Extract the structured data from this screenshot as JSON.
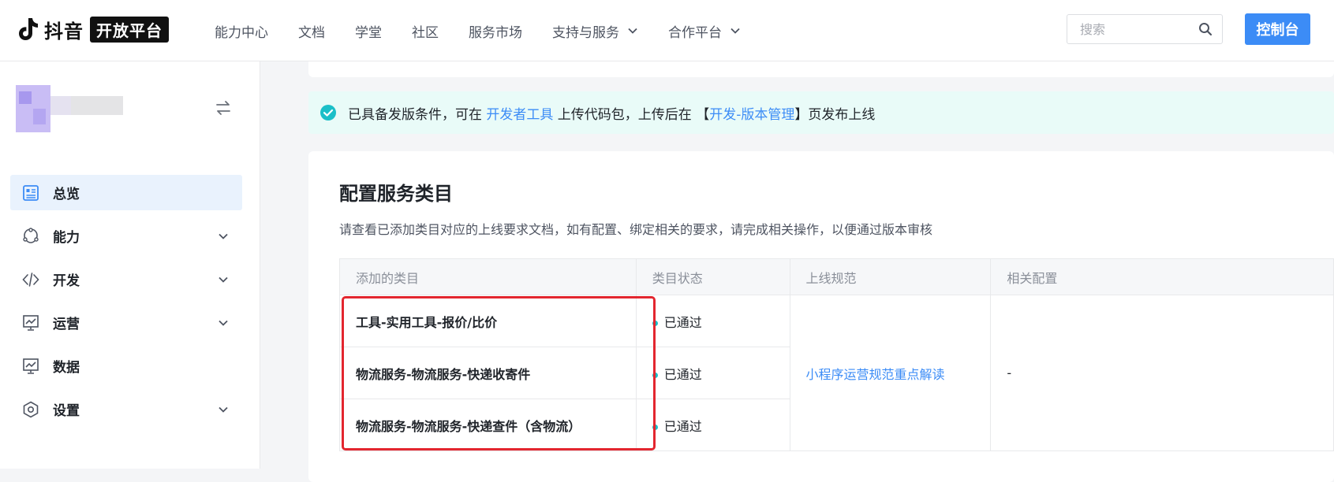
{
  "header": {
    "brand": "抖音",
    "platform_badge": "开放平台",
    "nav": [
      {
        "label": "能力中心"
      },
      {
        "label": "文档"
      },
      {
        "label": "学堂"
      },
      {
        "label": "社区"
      },
      {
        "label": "服务市场"
      },
      {
        "label": "支持与服务"
      },
      {
        "label": "合作平台"
      }
    ],
    "search_placeholder": "搜索",
    "console_label": "控制台"
  },
  "sidebar": {
    "items": [
      {
        "label": "总览"
      },
      {
        "label": "能力"
      },
      {
        "label": "开发"
      },
      {
        "label": "运营"
      },
      {
        "label": "数据"
      },
      {
        "label": "设置"
      }
    ]
  },
  "notice": {
    "text_before": "已具备发版条件，可在 ",
    "link1": "开发者工具",
    "text_mid": " 上传代码包，上传后在 【",
    "link2": "开发-版本管理",
    "text_after": "】页发布上线"
  },
  "category_card": {
    "title": "配置服务类目",
    "subtitle": "请查看已添加类目对应的上线要求文档，如有配置、绑定相关的要求，请完成相关操作，以便通过版本审核",
    "columns": [
      "添加的类目",
      "类目状态",
      "上线规范",
      "相关配置"
    ],
    "rows": [
      {
        "category": "工具-实用工具-报价/比价",
        "status": "已通过"
      },
      {
        "category": "物流服务-物流服务-快递收寄件",
        "status": "已通过"
      },
      {
        "category": "物流服务-物流服务-快递查件（含物流）",
        "status": "已通过"
      }
    ],
    "spec_link": "小程序运营规范重点解读",
    "config_value": "-"
  },
  "colors": {
    "primary": "#3c8cf6",
    "status_dot": "#1bbfc8",
    "highlight": "#e3262f",
    "notice_bg": "#e9fbf8"
  }
}
